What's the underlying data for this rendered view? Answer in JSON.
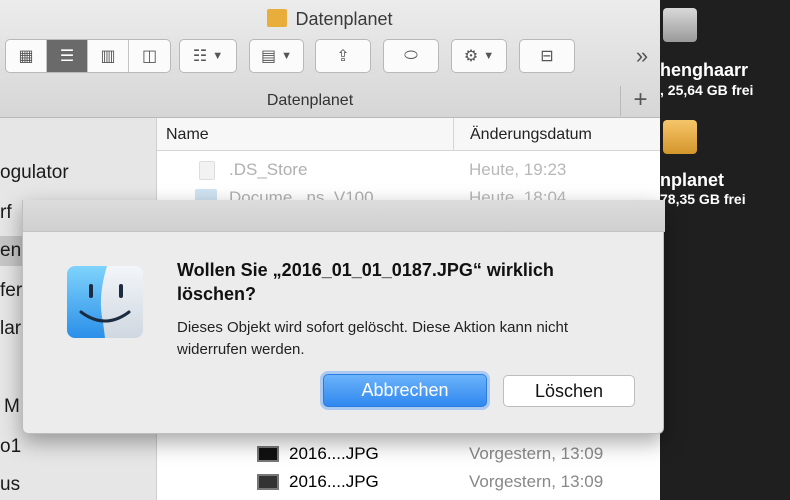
{
  "window": {
    "title": "Datenplanet",
    "path_title": "Datenplanet"
  },
  "toolbar": {
    "forward_more": "»"
  },
  "columns": {
    "name": "Name",
    "date": "Änderungsdatum"
  },
  "files": [
    {
      "name": ".DS_Store",
      "date": "Heute, 19:23"
    },
    {
      "name": "Docume...ns_V100",
      "date": "Heute, 18:04"
    },
    {
      "name": "2016....JPG",
      "date": "Vorgestern, 13:09"
    },
    {
      "name": "2016....JPG",
      "date": "Vorgestern, 13:09"
    }
  ],
  "sidebar": {
    "items": [
      "ogulator",
      "rf",
      "en",
      "fer",
      "lar",
      "M",
      "o1",
      "us"
    ]
  },
  "desktop": {
    "drives": [
      {
        "name": "henghaarr",
        "free": ", 25,64 GB frei"
      },
      {
        "name": "nplanet",
        "free": "78,35 GB frei"
      }
    ]
  },
  "dialog": {
    "title": "Wollen Sie „2016_01_01_0187.JPG“ wirklich löschen?",
    "message": "Dieses Objekt wird sofort gelöscht. Diese Aktion kann nicht widerrufen werden.",
    "cancel_label": "Abbrechen",
    "delete_label": "Löschen"
  },
  "colors": {
    "accent": "#2f88f0",
    "folder": "#e9ad3c"
  }
}
